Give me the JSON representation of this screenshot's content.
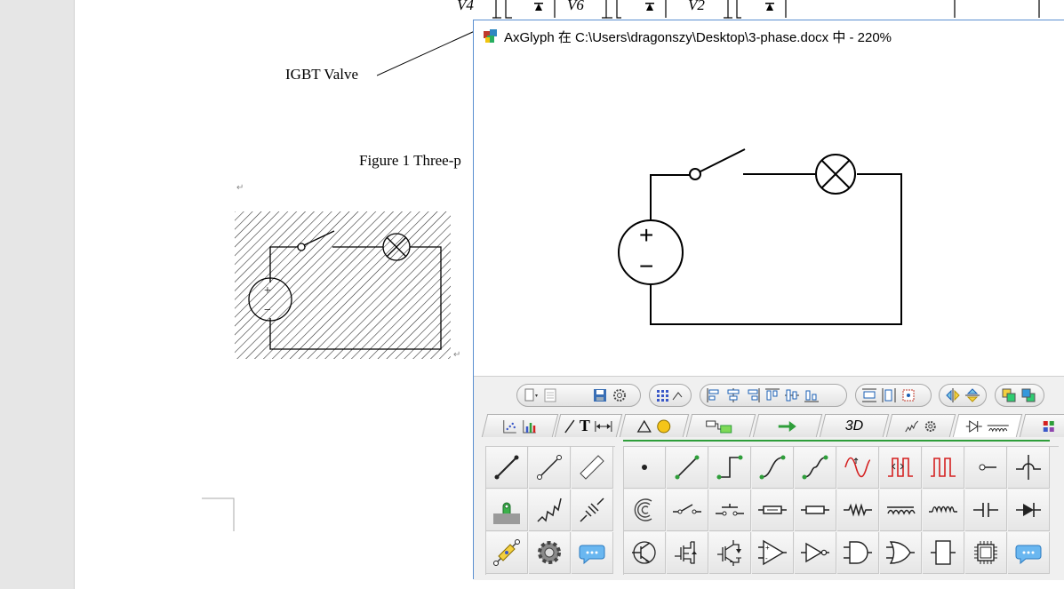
{
  "document": {
    "labels": {
      "v4": "V4",
      "v6": "V6",
      "v2": "V2",
      "igbt_valve": "IGBT Valve",
      "figure_caption": "Figure 1 Three-p"
    },
    "paragraph_mark": "↵"
  },
  "axglyph": {
    "title": "AxGlyph 在 C:\\Users\\dragonszy\\Desktop\\3-phase.docx 中 - 220%",
    "zoom": "220%",
    "circuit": {
      "source_plus": "+",
      "source_minus": "−",
      "components": [
        "voltage-source",
        "switch",
        "lamp"
      ]
    },
    "tabs": [
      {
        "name": "charts",
        "icons": [
          "scatter-chart-icon",
          "bar-chart-icon"
        ]
      },
      {
        "name": "lines-text",
        "icons": [
          "line-icon",
          "text-icon",
          "dimension-icon"
        ]
      },
      {
        "name": "shapes",
        "icons": [
          "triangle-icon",
          "circle-icon"
        ]
      },
      {
        "name": "flowchart",
        "icons": [
          "flowchart-icon"
        ]
      },
      {
        "name": "arrows",
        "icons": [
          "arrow-icon"
        ]
      },
      {
        "name": "3d",
        "label": "3D"
      },
      {
        "name": "mechanics",
        "icons": [
          "spring-icon",
          "gear-icon"
        ]
      },
      {
        "name": "electric",
        "icons": [
          "diode-icon",
          "inductor-icon"
        ],
        "active": true
      },
      {
        "name": "more",
        "icons": [
          "grid-icon"
        ]
      }
    ],
    "colors": {
      "accent_green": "#2e9e3a",
      "signal_red": "#d42020",
      "window_border": "#5a8fd0"
    }
  }
}
